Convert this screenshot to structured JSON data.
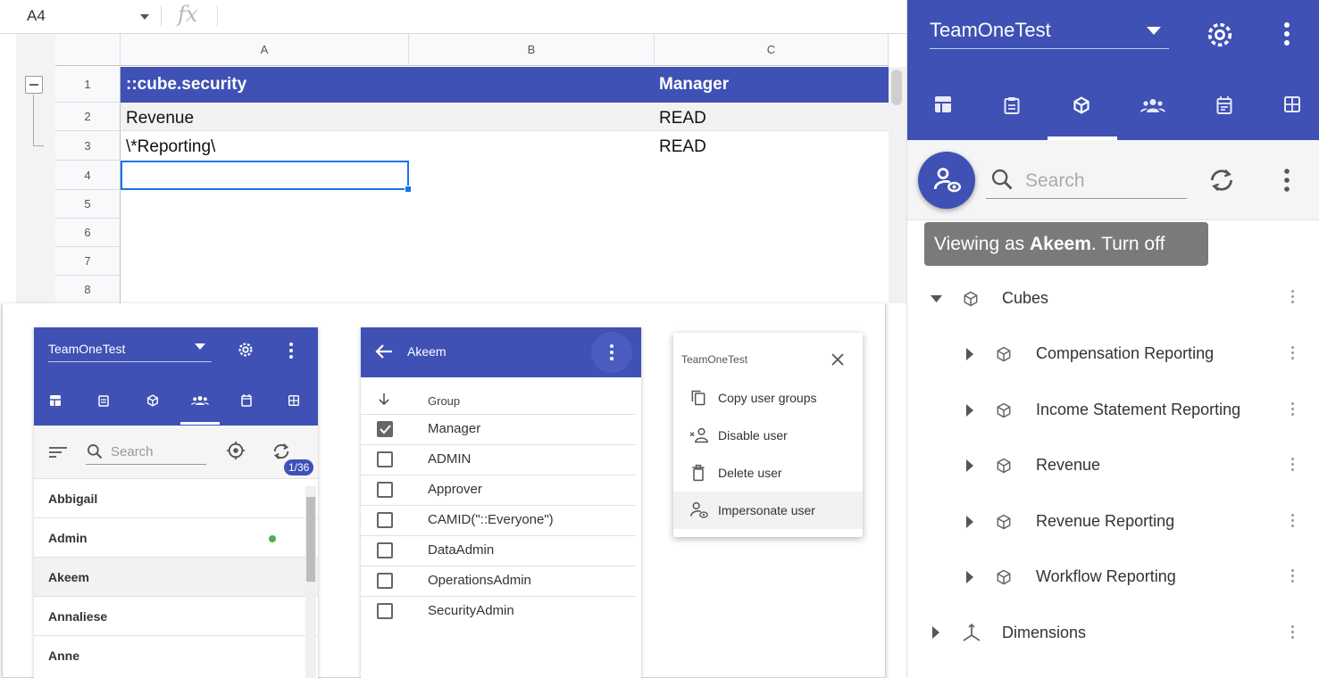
{
  "sheet": {
    "name_box": "A4",
    "fx_symbol": "fx",
    "columns": [
      "A",
      "B",
      "C"
    ],
    "rows": [
      "1",
      "2",
      "3",
      "4",
      "5",
      "6",
      "7",
      "8"
    ],
    "header_row": {
      "a": "::cube.security",
      "c": "Manager"
    },
    "row2": {
      "a": "Revenue",
      "c": "READ"
    },
    "row3": {
      "a": "\\*Reporting\\",
      "c": "READ"
    }
  },
  "panel_users": {
    "app_title": "TeamOneTest",
    "search_placeholder": "Search",
    "count_badge": "1/36",
    "users": [
      "Abbigail",
      "Admin",
      "Akeem",
      "Annaliese",
      "Anne"
    ]
  },
  "panel_groups": {
    "title": "Akeem",
    "column_header": "Group",
    "groups": [
      {
        "name": "Manager",
        "checked": true
      },
      {
        "name": "ADMIN",
        "checked": false
      },
      {
        "name": "Approver",
        "checked": false
      },
      {
        "name": "CAMID(\"::Everyone\")",
        "checked": false
      },
      {
        "name": "DataAdmin",
        "checked": false
      },
      {
        "name": "OperationsAdmin",
        "checked": false
      },
      {
        "name": "SecurityAdmin",
        "checked": false
      }
    ]
  },
  "panel_menu": {
    "title": "TeamOneTest",
    "items": [
      "Copy user groups",
      "Disable user",
      "Delete user",
      "Impersonate user"
    ]
  },
  "sidebar": {
    "title": "TeamOneTest",
    "search_placeholder": "Search",
    "tooltip": {
      "prefix": "Viewing as ",
      "user": "Akeem",
      "suffix": ". Turn off"
    },
    "tree": {
      "root_label": "Cubes",
      "children": [
        "Compensation Reporting",
        "Income Statement Reporting",
        "Revenue",
        "Revenue Reporting",
        "Workflow Reporting"
      ],
      "dimensions_label": "Dimensions"
    }
  },
  "colors": {
    "primary": "#3f51b5",
    "selection": "#1a73e8",
    "online": "#4caf50",
    "tooltip_bg": "#7a7a7a"
  }
}
